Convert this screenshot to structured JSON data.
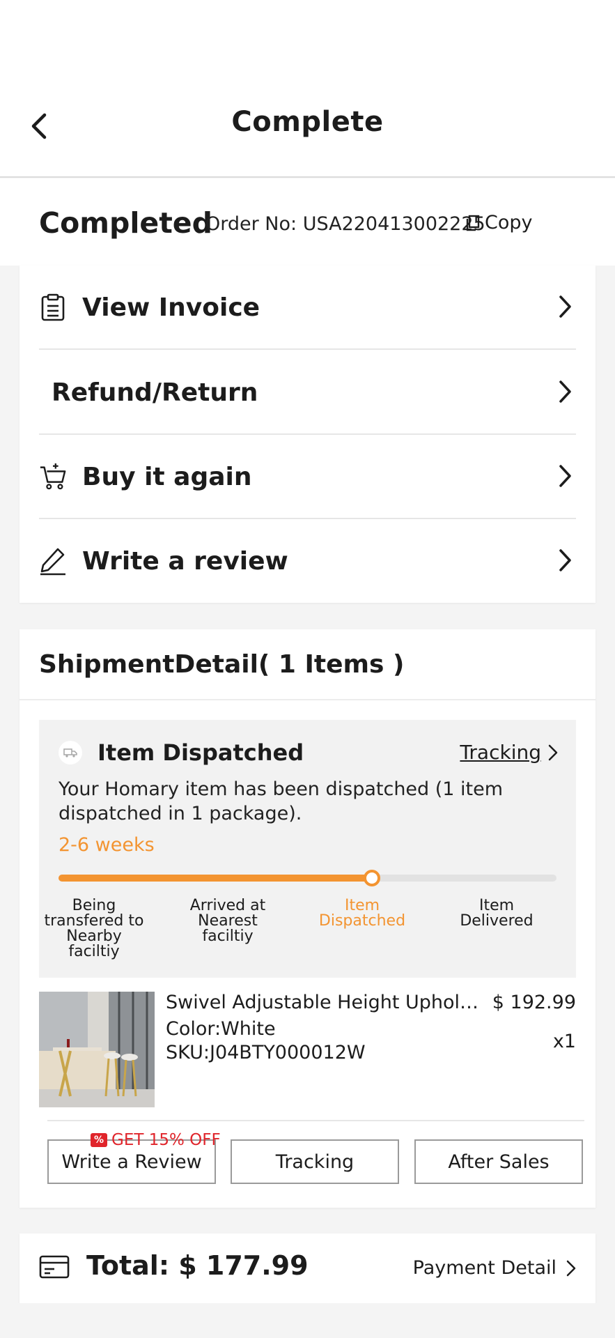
{
  "header": {
    "back_icon": "chevron-left-icon",
    "title": "Complete"
  },
  "order": {
    "status": "Completed",
    "order_no": "Order No: USA220413002225",
    "copy_label": "Copy"
  },
  "menu": {
    "items": [
      {
        "label": "View Invoice",
        "icon": "invoice-icon"
      },
      {
        "label": "Refund/Return",
        "icon": ""
      },
      {
        "label": "Buy it again",
        "icon": "cart-add-icon"
      },
      {
        "label": "Write a review",
        "icon": "pencil-icon"
      }
    ]
  },
  "shipment": {
    "header": "ShipmentDetail( 1 Items )",
    "dispatch": {
      "title": "Item Dispatched",
      "tracking_label": "Tracking",
      "message": "Your Homary item has been dispatched (1 item dispatched in 1 package).",
      "eta": "2-6 weeks",
      "progress": 0.63,
      "steps": [
        "Being transfered to Nearby faciltiy",
        "Arrived at Nearest faciltiy",
        "Item Dispatched",
        "Item Delivered"
      ],
      "active_step": 2
    },
    "product": {
      "name": "Swivel Adjustable Height Upholste...",
      "color": "Color:White",
      "sku": "SKU:J04BTY000012W",
      "price": "$ 192.99",
      "qty": "x1"
    },
    "promo": "GET 15% OFF",
    "buttons": {
      "review": "Write a Review",
      "tracking": "Tracking",
      "after_sales": "After Sales"
    }
  },
  "total": {
    "label": "Total: $ 177.99",
    "payment_link": "Payment Detail"
  },
  "colors": {
    "accent": "#f39431",
    "promo": "#e0252b",
    "text": "#1c1c1c"
  }
}
